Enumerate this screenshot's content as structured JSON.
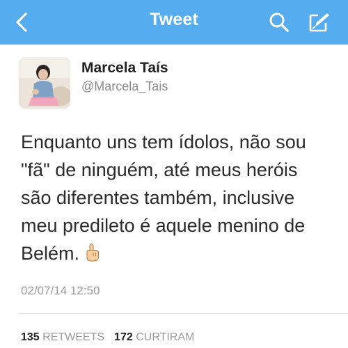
{
  "navbar": {
    "title": "Tweet",
    "color": "#55acee",
    "icons": [
      "back-chevron-icon",
      "search-icon",
      "compose-icon"
    ]
  },
  "user": {
    "name": "Marcela Taís",
    "handle": "@Marcela_Tais"
  },
  "tweet": {
    "lines": [
      "Enquanto uns tem ídolos, não sou",
      "\"fã\" de ninguém, até meus heróis",
      "são diferentes também, inclusive",
      "meu predileto é aquele menino de",
      "Belém."
    ],
    "emoji": "pointing-up-hand-icon",
    "timestamp": "02/07/14 12:50"
  },
  "stats": {
    "retweets_count": "135",
    "retweets_label": "RETWEETS",
    "likes_count": "172",
    "likes_label": "CURTIRAM"
  }
}
